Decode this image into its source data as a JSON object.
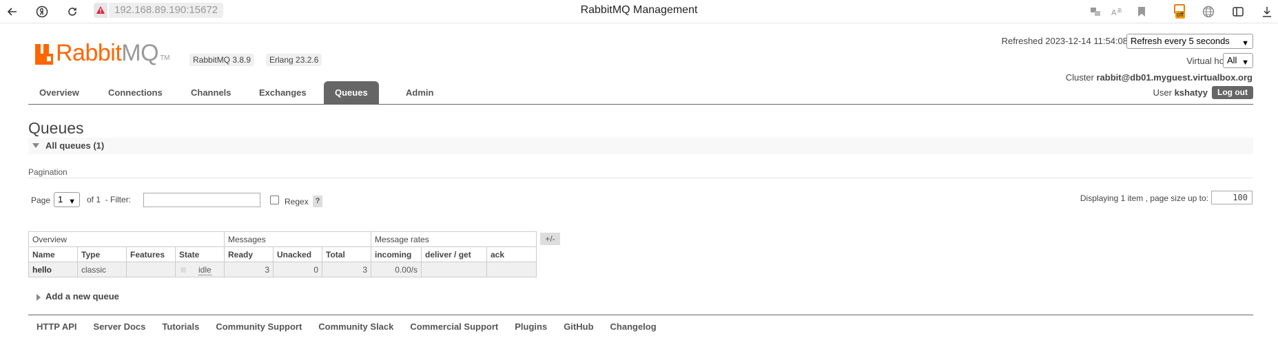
{
  "browser": {
    "address": "192.168.89.190:15672",
    "tab_title": "RabbitMQ Management",
    "icons": [
      "back-icon",
      "yandex-icon",
      "reload-icon",
      "warning-icon",
      "translate-icon",
      "reader-mode-icon",
      "bookmark-icon",
      "extension-off-icon",
      "globe-icon",
      "sidebar-icon",
      "download-icon"
    ],
    "extension_badge": "off"
  },
  "header": {
    "logo_rabbit": "Rabbit",
    "logo_mq": "MQ",
    "logo_tm": "TM",
    "rabbitmq_version": "RabbitMQ 3.8.9",
    "erlang_version": "Erlang 23.2.6",
    "refreshed_label": "Refreshed 2023-12-14 11:54:08",
    "refresh_select": "Refresh every 5 seconds",
    "virtual_host_label": "Virtual host",
    "virtual_host_select": "All",
    "cluster_label": "Cluster",
    "cluster_name": "rabbit@db01.myguest.virtualbox.org",
    "user_label": "User",
    "user_name": "kshatyy",
    "logout": "Log out"
  },
  "nav": {
    "tabs": [
      {
        "label": "Overview"
      },
      {
        "label": "Connections"
      },
      {
        "label": "Channels"
      },
      {
        "label": "Exchanges"
      },
      {
        "label": "Queues",
        "active": true
      },
      {
        "label": "Admin"
      }
    ]
  },
  "page": {
    "title": "Queues",
    "section_title": "All queues (1)",
    "pagination_label": "Pagination",
    "page_label": "Page",
    "page_select": "1",
    "of_label": "of 1",
    "filter_label": "- Filter:",
    "filter_value": "",
    "regex_label": "Regex",
    "help": "?",
    "displaying": "Displaying 1 item , page size up to:",
    "page_size": "100",
    "plus_minus": "+/-",
    "add_queue": "Add a new queue"
  },
  "table": {
    "groups": [
      "Overview",
      "Messages",
      "Message rates"
    ],
    "columns": [
      "Name",
      "Type",
      "Features",
      "State",
      "Ready",
      "Unacked",
      "Total",
      "incoming",
      "deliver / get",
      "ack"
    ],
    "rows": [
      {
        "name": "hello",
        "type": "classic",
        "features": "",
        "state": "idle",
        "ready": "3",
        "unacked": "0",
        "total": "3",
        "incoming": "0.00/s",
        "deliver_get": "",
        "ack": ""
      }
    ]
  },
  "footer": {
    "links": [
      "HTTP API",
      "Server Docs",
      "Tutorials",
      "Community Support",
      "Community Slack",
      "Commercial Support",
      "Plugins",
      "GitHub",
      "Changelog"
    ]
  },
  "colors": {
    "brand": "#ff6600",
    "active_tab": "#666666"
  }
}
